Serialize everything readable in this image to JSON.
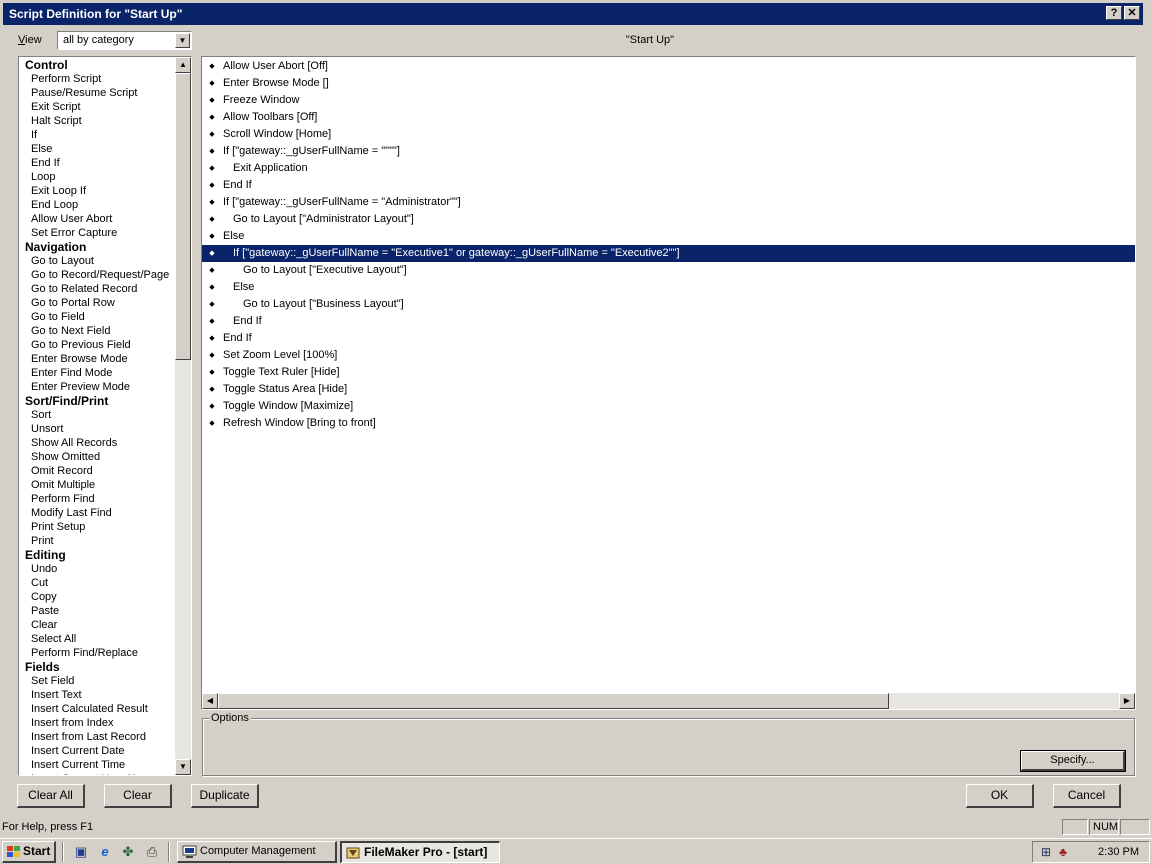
{
  "window": {
    "title": "Script Definition for \"Start Up\"",
    "help_glyph": "?",
    "close_glyph": "✕"
  },
  "view": {
    "label_prefix": "V",
    "label_rest": "iew",
    "selected": "all by category"
  },
  "script_name": "\"Start Up\"",
  "commands": [
    {
      "type": "cat",
      "label": "Control"
    },
    {
      "type": "item",
      "label": "Perform Script"
    },
    {
      "type": "item",
      "label": "Pause/Resume Script"
    },
    {
      "type": "item",
      "label": "Exit Script"
    },
    {
      "type": "item",
      "label": "Halt Script"
    },
    {
      "type": "item",
      "label": "If"
    },
    {
      "type": "item",
      "label": "Else"
    },
    {
      "type": "item",
      "label": "End If"
    },
    {
      "type": "item",
      "label": "Loop"
    },
    {
      "type": "item",
      "label": "Exit Loop If"
    },
    {
      "type": "item",
      "label": "End Loop"
    },
    {
      "type": "item",
      "label": "Allow User Abort"
    },
    {
      "type": "item",
      "label": "Set Error Capture"
    },
    {
      "type": "cat",
      "label": "Navigation"
    },
    {
      "type": "item",
      "label": "Go to Layout"
    },
    {
      "type": "item",
      "label": "Go to Record/Request/Page"
    },
    {
      "type": "item",
      "label": "Go to Related Record"
    },
    {
      "type": "item",
      "label": "Go to Portal Row"
    },
    {
      "type": "item",
      "label": "Go to Field"
    },
    {
      "type": "item",
      "label": "Go to Next Field"
    },
    {
      "type": "item",
      "label": "Go to Previous Field"
    },
    {
      "type": "item",
      "label": "Enter Browse Mode"
    },
    {
      "type": "item",
      "label": "Enter Find Mode"
    },
    {
      "type": "item",
      "label": "Enter Preview Mode"
    },
    {
      "type": "cat",
      "label": "Sort/Find/Print"
    },
    {
      "type": "item",
      "label": "Sort"
    },
    {
      "type": "item",
      "label": "Unsort"
    },
    {
      "type": "item",
      "label": "Show All Records"
    },
    {
      "type": "item",
      "label": "Show Omitted"
    },
    {
      "type": "item",
      "label": "Omit Record"
    },
    {
      "type": "item",
      "label": "Omit Multiple"
    },
    {
      "type": "item",
      "label": "Perform Find"
    },
    {
      "type": "item",
      "label": "Modify Last Find"
    },
    {
      "type": "item",
      "label": "Print Setup"
    },
    {
      "type": "item",
      "label": "Print"
    },
    {
      "type": "cat",
      "label": "Editing"
    },
    {
      "type": "item",
      "label": "Undo"
    },
    {
      "type": "item",
      "label": "Cut"
    },
    {
      "type": "item",
      "label": "Copy"
    },
    {
      "type": "item",
      "label": "Paste"
    },
    {
      "type": "item",
      "label": "Clear"
    },
    {
      "type": "item",
      "label": "Select All"
    },
    {
      "type": "item",
      "label": "Perform Find/Replace"
    },
    {
      "type": "cat",
      "label": "Fields"
    },
    {
      "type": "item",
      "label": "Set Field"
    },
    {
      "type": "item",
      "label": "Insert Text"
    },
    {
      "type": "item",
      "label": "Insert Calculated Result"
    },
    {
      "type": "item",
      "label": "Insert from Index"
    },
    {
      "type": "item",
      "label": "Insert from Last Record"
    },
    {
      "type": "item",
      "label": "Insert Current Date"
    },
    {
      "type": "item",
      "label": "Insert Current Time"
    },
    {
      "type": "item",
      "label": "Insert Current User Name"
    }
  ],
  "steps": [
    {
      "indent": 0,
      "text": "Allow User Abort [Off]"
    },
    {
      "indent": 0,
      "text": "Enter Browse Mode []"
    },
    {
      "indent": 0,
      "text": "Freeze Window"
    },
    {
      "indent": 0,
      "text": "Allow Toolbars [Off]"
    },
    {
      "indent": 0,
      "text": "Scroll Window [Home]"
    },
    {
      "indent": 0,
      "text": "If [\"gateway::_gUserFullName = \"\"\"\"]"
    },
    {
      "indent": 1,
      "text": "Exit Application"
    },
    {
      "indent": 0,
      "text": "End If"
    },
    {
      "indent": 0,
      "text": "If [\"gateway::_gUserFullName = \"Administrator\"\"]"
    },
    {
      "indent": 1,
      "text": "Go to Layout [\"Administrator Layout\"]"
    },
    {
      "indent": 0,
      "text": "Else"
    },
    {
      "indent": 1,
      "text": "If [\"gateway::_gUserFullName = \"Executive1\" or gateway::_gUserFullName = \"Executive2\"\"]",
      "selected": true
    },
    {
      "indent": 2,
      "text": "Go to Layout [\"Executive Layout\"]"
    },
    {
      "indent": 1,
      "text": "Else"
    },
    {
      "indent": 2,
      "text": "Go to Layout [\"Business Layout\"]"
    },
    {
      "indent": 1,
      "text": "End If"
    },
    {
      "indent": 0,
      "text": "End If"
    },
    {
      "indent": 0,
      "text": "Set Zoom Level [100%]"
    },
    {
      "indent": 0,
      "text": "Toggle Text Ruler [Hide]"
    },
    {
      "indent": 0,
      "text": "Toggle Status Area [Hide]"
    },
    {
      "indent": 0,
      "text": "Toggle Window [Maximize]"
    },
    {
      "indent": 0,
      "text": "Refresh Window [Bring to front]"
    }
  ],
  "options": {
    "label": "Options",
    "specify_label": "Specify..."
  },
  "buttons": {
    "clear_all": "Clear All",
    "clear": "Clear",
    "duplicate": "Duplicate",
    "ok": "OK",
    "cancel": "Cancel"
  },
  "status": {
    "help_text": "For Help, press F1",
    "num": "NUM"
  },
  "taskbar": {
    "start_label": "Start",
    "tasks": [
      {
        "label": "Computer Management",
        "active": false
      },
      {
        "label": "FileMaker Pro - [start]",
        "active": true
      }
    ],
    "clock": "2:30 PM"
  }
}
